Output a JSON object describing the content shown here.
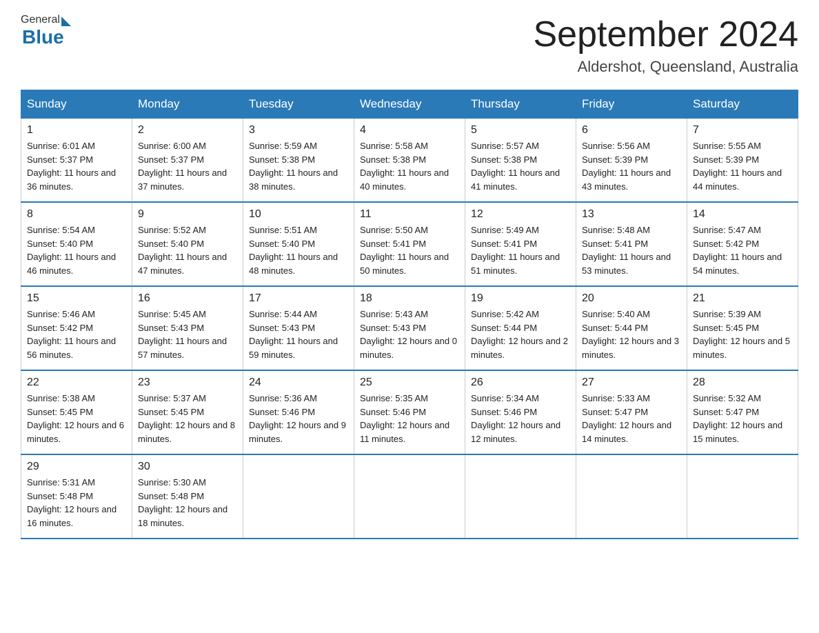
{
  "header": {
    "logo_general": "General",
    "logo_blue": "Blue",
    "title": "September 2024",
    "location": "Aldershot, Queensland, Australia"
  },
  "days_of_week": [
    "Sunday",
    "Monday",
    "Tuesday",
    "Wednesday",
    "Thursday",
    "Friday",
    "Saturday"
  ],
  "weeks": [
    [
      {
        "day": "1",
        "sunrise": "6:01 AM",
        "sunset": "5:37 PM",
        "daylight": "11 hours and 36 minutes."
      },
      {
        "day": "2",
        "sunrise": "6:00 AM",
        "sunset": "5:37 PM",
        "daylight": "11 hours and 37 minutes."
      },
      {
        "day": "3",
        "sunrise": "5:59 AM",
        "sunset": "5:38 PM",
        "daylight": "11 hours and 38 minutes."
      },
      {
        "day": "4",
        "sunrise": "5:58 AM",
        "sunset": "5:38 PM",
        "daylight": "11 hours and 40 minutes."
      },
      {
        "day": "5",
        "sunrise": "5:57 AM",
        "sunset": "5:38 PM",
        "daylight": "11 hours and 41 minutes."
      },
      {
        "day": "6",
        "sunrise": "5:56 AM",
        "sunset": "5:39 PM",
        "daylight": "11 hours and 43 minutes."
      },
      {
        "day": "7",
        "sunrise": "5:55 AM",
        "sunset": "5:39 PM",
        "daylight": "11 hours and 44 minutes."
      }
    ],
    [
      {
        "day": "8",
        "sunrise": "5:54 AM",
        "sunset": "5:40 PM",
        "daylight": "11 hours and 46 minutes."
      },
      {
        "day": "9",
        "sunrise": "5:52 AM",
        "sunset": "5:40 PM",
        "daylight": "11 hours and 47 minutes."
      },
      {
        "day": "10",
        "sunrise": "5:51 AM",
        "sunset": "5:40 PM",
        "daylight": "11 hours and 48 minutes."
      },
      {
        "day": "11",
        "sunrise": "5:50 AM",
        "sunset": "5:41 PM",
        "daylight": "11 hours and 50 minutes."
      },
      {
        "day": "12",
        "sunrise": "5:49 AM",
        "sunset": "5:41 PM",
        "daylight": "11 hours and 51 minutes."
      },
      {
        "day": "13",
        "sunrise": "5:48 AM",
        "sunset": "5:41 PM",
        "daylight": "11 hours and 53 minutes."
      },
      {
        "day": "14",
        "sunrise": "5:47 AM",
        "sunset": "5:42 PM",
        "daylight": "11 hours and 54 minutes."
      }
    ],
    [
      {
        "day": "15",
        "sunrise": "5:46 AM",
        "sunset": "5:42 PM",
        "daylight": "11 hours and 56 minutes."
      },
      {
        "day": "16",
        "sunrise": "5:45 AM",
        "sunset": "5:43 PM",
        "daylight": "11 hours and 57 minutes."
      },
      {
        "day": "17",
        "sunrise": "5:44 AM",
        "sunset": "5:43 PM",
        "daylight": "11 hours and 59 minutes."
      },
      {
        "day": "18",
        "sunrise": "5:43 AM",
        "sunset": "5:43 PM",
        "daylight": "12 hours and 0 minutes."
      },
      {
        "day": "19",
        "sunrise": "5:42 AM",
        "sunset": "5:44 PM",
        "daylight": "12 hours and 2 minutes."
      },
      {
        "day": "20",
        "sunrise": "5:40 AM",
        "sunset": "5:44 PM",
        "daylight": "12 hours and 3 minutes."
      },
      {
        "day": "21",
        "sunrise": "5:39 AM",
        "sunset": "5:45 PM",
        "daylight": "12 hours and 5 minutes."
      }
    ],
    [
      {
        "day": "22",
        "sunrise": "5:38 AM",
        "sunset": "5:45 PM",
        "daylight": "12 hours and 6 minutes."
      },
      {
        "day": "23",
        "sunrise": "5:37 AM",
        "sunset": "5:45 PM",
        "daylight": "12 hours and 8 minutes."
      },
      {
        "day": "24",
        "sunrise": "5:36 AM",
        "sunset": "5:46 PM",
        "daylight": "12 hours and 9 minutes."
      },
      {
        "day": "25",
        "sunrise": "5:35 AM",
        "sunset": "5:46 PM",
        "daylight": "12 hours and 11 minutes."
      },
      {
        "day": "26",
        "sunrise": "5:34 AM",
        "sunset": "5:46 PM",
        "daylight": "12 hours and 12 minutes."
      },
      {
        "day": "27",
        "sunrise": "5:33 AM",
        "sunset": "5:47 PM",
        "daylight": "12 hours and 14 minutes."
      },
      {
        "day": "28",
        "sunrise": "5:32 AM",
        "sunset": "5:47 PM",
        "daylight": "12 hours and 15 minutes."
      }
    ],
    [
      {
        "day": "29",
        "sunrise": "5:31 AM",
        "sunset": "5:48 PM",
        "daylight": "12 hours and 16 minutes."
      },
      {
        "day": "30",
        "sunrise": "5:30 AM",
        "sunset": "5:48 PM",
        "daylight": "12 hours and 18 minutes."
      },
      {
        "day": "",
        "sunrise": "",
        "sunset": "",
        "daylight": ""
      },
      {
        "day": "",
        "sunrise": "",
        "sunset": "",
        "daylight": ""
      },
      {
        "day": "",
        "sunrise": "",
        "sunset": "",
        "daylight": ""
      },
      {
        "day": "",
        "sunrise": "",
        "sunset": "",
        "daylight": ""
      },
      {
        "day": "",
        "sunrise": "",
        "sunset": "",
        "daylight": ""
      }
    ]
  ],
  "labels": {
    "sunrise": "Sunrise:",
    "sunset": "Sunset:",
    "daylight": "Daylight:"
  }
}
